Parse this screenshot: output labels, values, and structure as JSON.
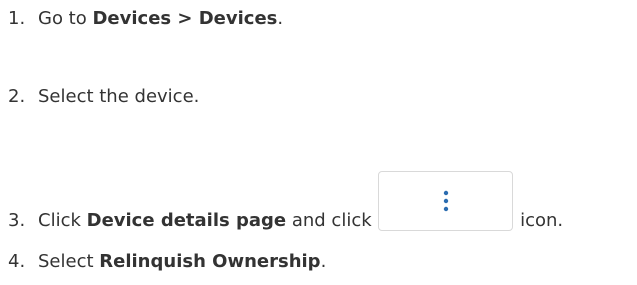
{
  "steps": [
    {
      "number": "1.",
      "parts": [
        "Go to ",
        "Devices > Devices",
        "."
      ]
    },
    {
      "number": "2.",
      "text": "Select the device."
    },
    {
      "number": "3.",
      "parts": [
        "Click ",
        "Device details page",
        " and click ",
        " icon."
      ],
      "icon": "more-vertical-icon"
    },
    {
      "number": "4.",
      "parts": [
        "Select ",
        "Relinquish Ownership",
        "."
      ]
    }
  ],
  "colors": {
    "text": "#333333",
    "icon_dots": "#2b6cb0",
    "button_border": "#d9d9d9"
  }
}
